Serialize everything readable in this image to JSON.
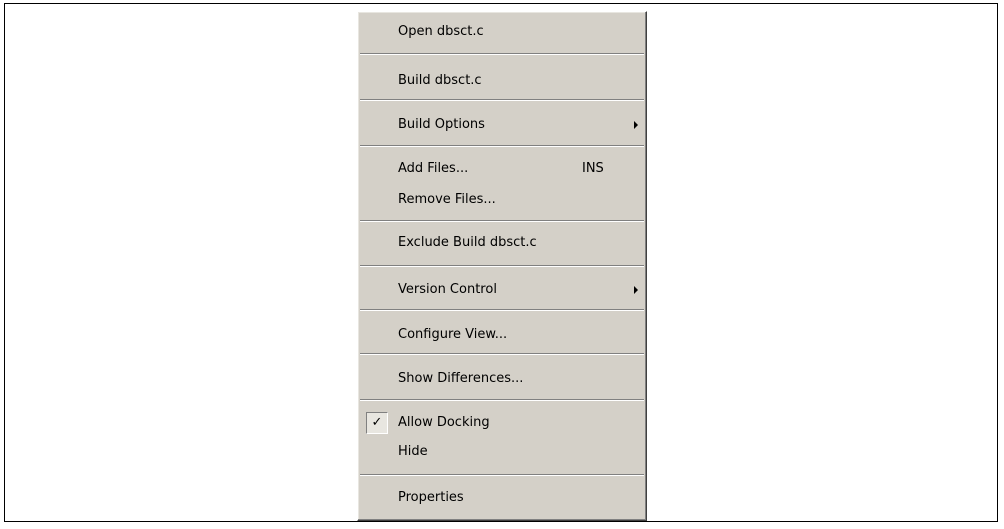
{
  "menu": {
    "items": [
      {
        "label": "Open dbsct.c"
      },
      {
        "label": "Build dbsct.c"
      },
      {
        "label": "Build Options"
      },
      {
        "label": "Add Files...",
        "shortcut": "INS"
      },
      {
        "label": "Remove Files..."
      },
      {
        "label": "Exclude Build dbsct.c"
      },
      {
        "label": "Version Control"
      },
      {
        "label": "Configure View..."
      },
      {
        "label": "Show Differences..."
      },
      {
        "label": "Allow Docking",
        "checked": true,
        "check_glyph": "✓"
      },
      {
        "label": "Hide"
      },
      {
        "label": "Properties"
      }
    ]
  },
  "colors": {
    "menu_background": "#d4d0c8",
    "frame_border": "#000000",
    "text": "#000000"
  }
}
